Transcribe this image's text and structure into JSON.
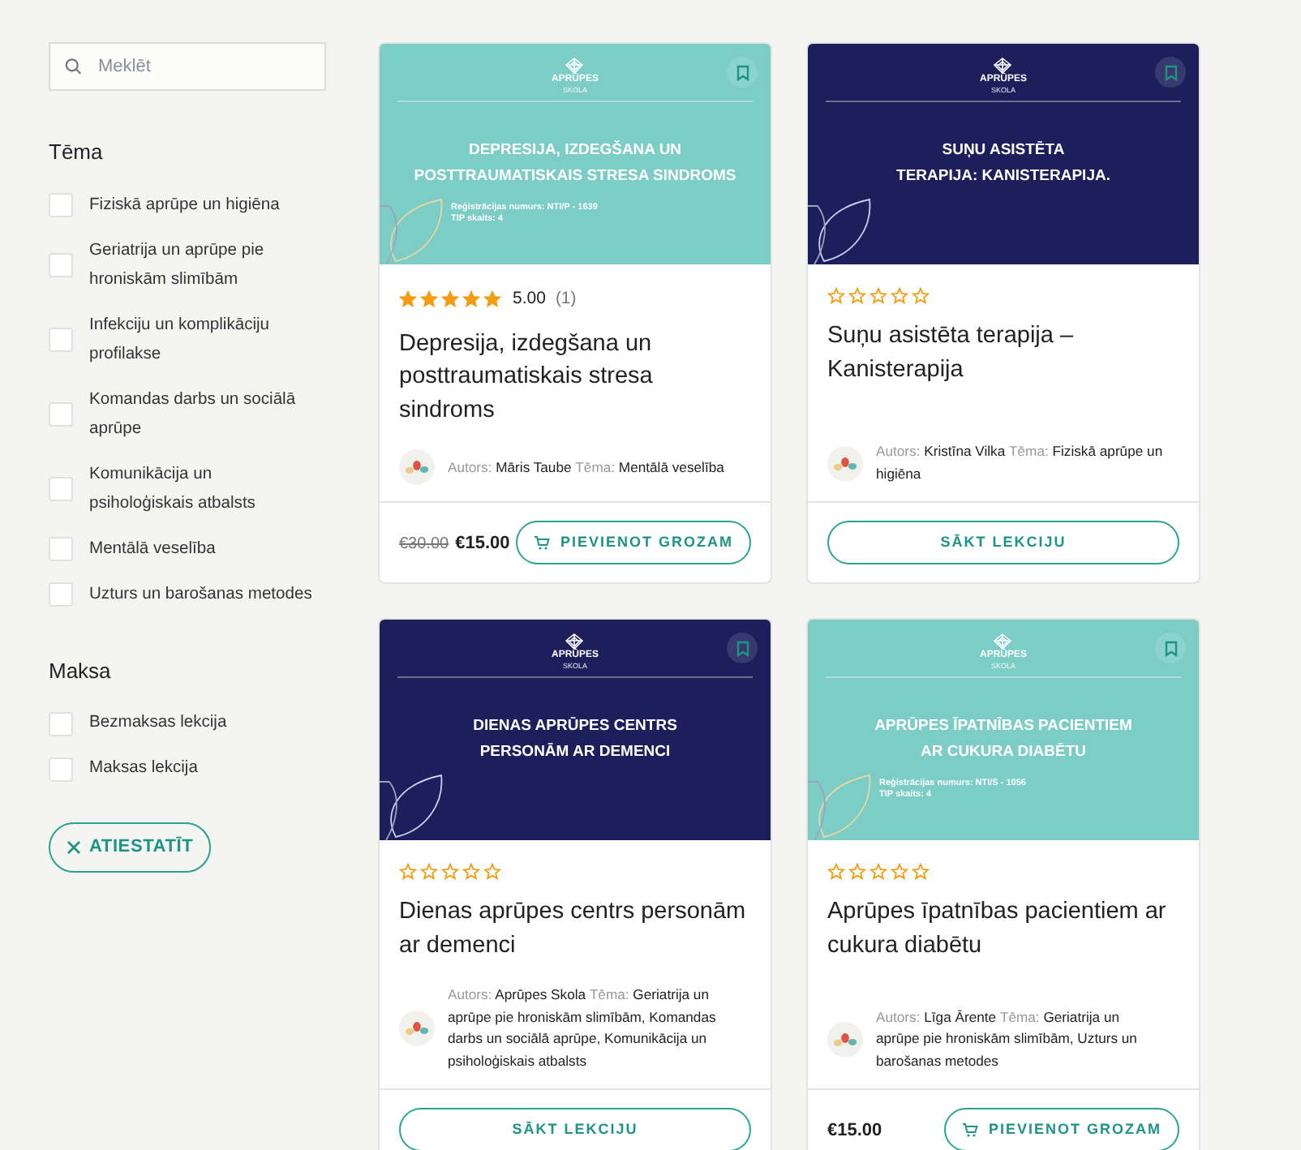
{
  "search": {
    "placeholder": "Meklēt"
  },
  "filters": [
    {
      "title": "Tēma",
      "options": [
        {
          "label": "Fiziskā aprūpe un higiēna",
          "checked": false
        },
        {
          "label": "Geriatrija un aprūpe pie hroniskām slimībām",
          "checked": false
        },
        {
          "label": "Infekciju un komplikāciju profilakse",
          "checked": false
        },
        {
          "label": "Komandas darbs un sociālā aprūpe",
          "checked": false
        },
        {
          "label": "Komunikācija un psiholoģiskais atbalsts",
          "checked": false
        },
        {
          "label": "Mentālā veselība",
          "checked": false
        },
        {
          "label": "Uzturs un barošanas metodes",
          "checked": false
        }
      ]
    },
    {
      "title": "Maksa",
      "options": [
        {
          "label": "Bezmaksas lekcija",
          "checked": false
        },
        {
          "label": "Maksas lekcija",
          "checked": false
        }
      ]
    }
  ],
  "reset_button": {
    "label": "ATIESTATĪT"
  },
  "courses": [
    {
      "banner": {
        "color": "#7ccdc6",
        "logo": "APRŪPES",
        "logo_sub": "SKOLA",
        "title": "DEPRESIJA, IZDEGŠANA UN POSTTRAUMATISKAIS STRESA SINDROMS",
        "reg_lines": [
          "Reģistrācijas numurs: NTI/P - 1639",
          "TIP skaits: 4"
        ]
      },
      "stars": 5,
      "rating": "5.00",
      "rating_count": "(1)",
      "title": "Depresija, izdegšana un posttraumatiskais stresa sindroms",
      "author_label": "Autors:",
      "author": "Māris Taube",
      "topic_label": "Tēma:",
      "topic": "Mentālā veselība",
      "old_price": "€30.00",
      "price": "€15.00",
      "button": {
        "kind": "cart",
        "label": "PIEVIENOT GROZAM"
      }
    },
    {
      "banner": {
        "color": "#1d1f5c",
        "logo": "APRŪPES",
        "logo_sub": "SKOLA",
        "title": "SUŅU ASISTĒTA TERAPIJA: KANISTERAPIJA."
      },
      "stars": 0,
      "title": "Suņu asistēta terapija – Kanisterapija",
      "author_label": "Autors:",
      "author": "Kristīna Vilka",
      "topic_label": "Tēma:",
      "topic": "Fiziskā aprūpe un higiēna",
      "button": {
        "kind": "start",
        "label": "SĀKT LEKCIJU"
      }
    },
    {
      "banner": {
        "color": "#1d1f5c",
        "logo": "APRŪPES",
        "logo_sub": "SKOLA",
        "title": "DIENAS APRŪPES CENTRS PERSONĀM AR DEMENCI"
      },
      "stars": 0,
      "title": "Dienas aprūpes centrs personām ar demenci",
      "author_label": "Autors:",
      "author": "Aprūpes Skola",
      "topic_label": "Tēma:",
      "topic": "Geriatrija un aprūpe pie hroniskām slimībām, Komandas darbs un sociālā aprūpe, Komunikācija un psiholoģiskais atbalsts",
      "button": {
        "kind": "start",
        "label": "SĀKT LEKCIJU"
      }
    },
    {
      "banner": {
        "color": "#7ccdc6",
        "logo": "APRŪPES",
        "logo_sub": "SKOLA",
        "title": "APRŪPES ĪPATNĪBAS PACIENTIEM AR CUKURA DIABĒTU",
        "reg_lines": [
          "Reģistrācijas numurs: NTI/S - 1056",
          "TIP skaits: 4"
        ]
      },
      "stars": 0,
      "title": "Aprūpes īpatnības pacientiem ar cukura diabētu",
      "author_label": "Autors:",
      "author": "Līga Ārente",
      "topic_label": "Tēma:",
      "topic": "Geriatrija un aprūpe pie hroniskām slimībām, Uzturs un barošanas metodes",
      "price": "€15.00",
      "button": {
        "kind": "cart",
        "label": "PIEVIENOT GROZAM"
      }
    }
  ]
}
